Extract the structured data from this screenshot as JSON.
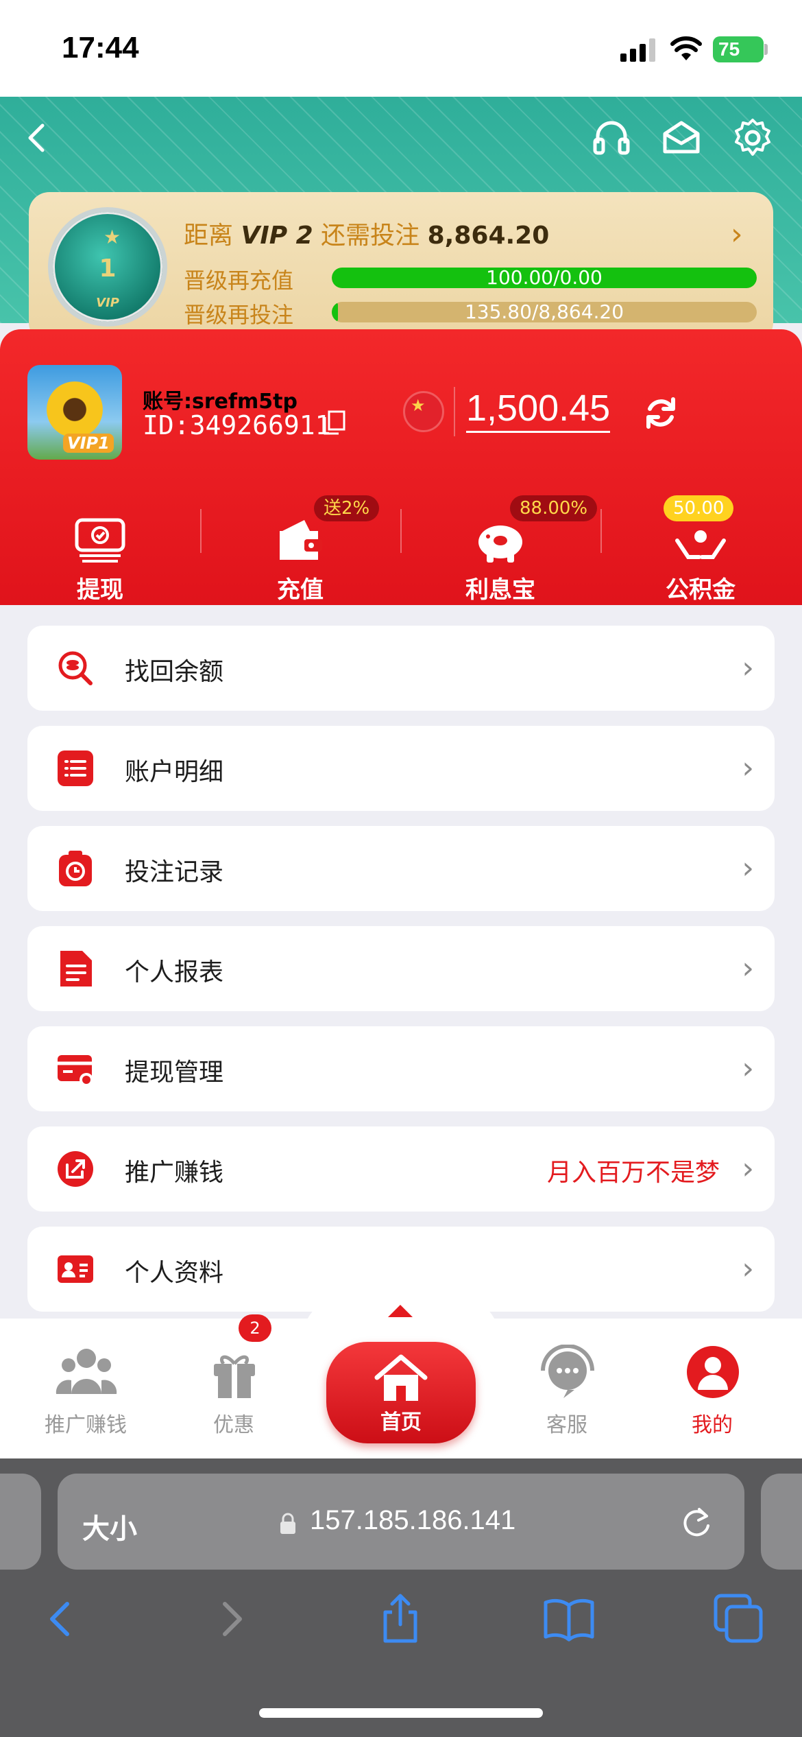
{
  "status_bar": {
    "time": "17:44",
    "battery": "75"
  },
  "vip": {
    "prefix": "距离",
    "level": "VIP 2",
    "middle": "还需投注",
    "amount": "8,864.20",
    "medal_level": "1",
    "medal_text": "VIP",
    "recharge_label": "晋级再充值",
    "recharge_progress": "100.00/0.00",
    "recharge_fraction": 1.0,
    "bet_label": "晋级再投注",
    "bet_progress": "135.80/8,864.20",
    "bet_fraction": 0.0153
  },
  "account": {
    "avatar_badge": "VIP1",
    "username_line": "账号:srefm5tp",
    "id_line": "ID:349266911",
    "balance": "1,500.45"
  },
  "quick_actions": [
    {
      "label": "提现",
      "badge": ""
    },
    {
      "label": "充值",
      "badge": "送2%"
    },
    {
      "label": "利息宝",
      "badge": "88.00%"
    },
    {
      "label": "公积金",
      "badge": "50.00"
    }
  ],
  "menu": [
    {
      "label": "找回余额",
      "extra": ""
    },
    {
      "label": "账户明细",
      "extra": ""
    },
    {
      "label": "投注记录",
      "extra": ""
    },
    {
      "label": "个人报表",
      "extra": ""
    },
    {
      "label": "提现管理",
      "extra": ""
    },
    {
      "label": "推广赚钱",
      "extra": "月入百万不是梦"
    },
    {
      "label": "个人资料",
      "extra": ""
    }
  ],
  "tabbar": {
    "promote": "推广赚钱",
    "offers": "优惠",
    "offers_badge": "2",
    "home": "首页",
    "service": "客服",
    "mine": "我的"
  },
  "browser": {
    "text_size": "大小",
    "url": "157.185.186.141"
  },
  "colors": {
    "accent_red": "#e31b1f",
    "teal": "#3cb9a4",
    "gold": "#c8841a",
    "progress_green": "#14c10f"
  }
}
